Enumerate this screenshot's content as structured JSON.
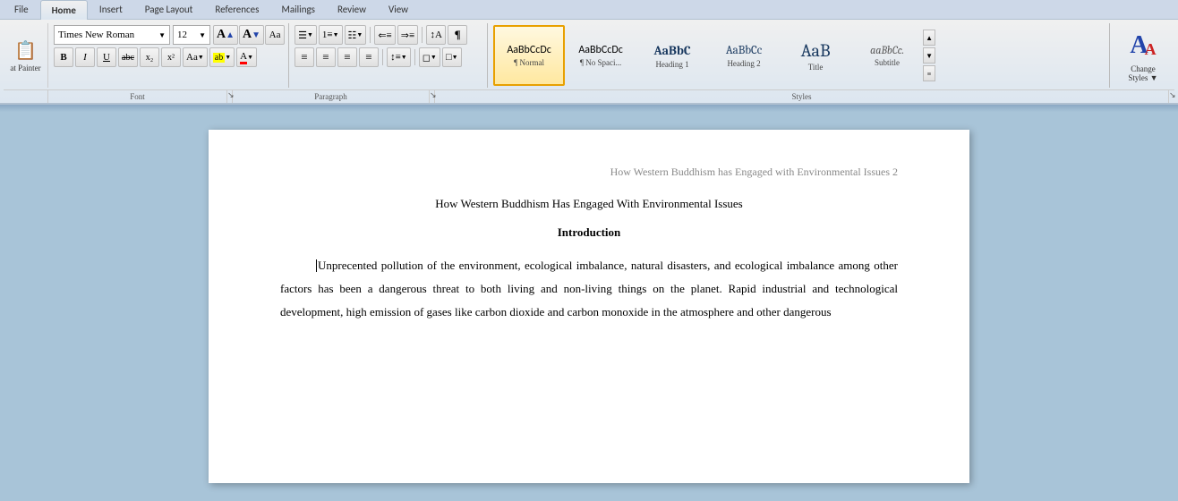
{
  "ribbon": {
    "tabs": [
      "File",
      "Home",
      "Insert",
      "Page Layout",
      "References",
      "Mailings",
      "Review",
      "View"
    ],
    "active_tab": "Home"
  },
  "toolbar": {
    "format_painter_label": "at Painter",
    "font": {
      "name": "Times New Roman",
      "size": "12",
      "grow_label": "A",
      "shrink_label": "A",
      "clear_label": "Aa",
      "bold": "B",
      "italic": "I",
      "underline": "U",
      "strikethrough": "abc",
      "subscript": "x₂",
      "superscript": "x²",
      "font_color": "A",
      "highlight": "ab"
    },
    "paragraph": {
      "bullets_label": "≡",
      "numbering_label": "≡",
      "multilevel_label": "≡",
      "decrease_indent": "⇐",
      "increase_indent": "⇒",
      "sort_label": "↕",
      "show_all_label": "¶",
      "align_left": "≡",
      "align_center": "≡",
      "align_right": "≡",
      "justify": "≡",
      "line_spacing": "↕",
      "shading": "◻",
      "borders": "□",
      "label": "Paragraph"
    },
    "styles": {
      "label": "Styles",
      "items": [
        {
          "name": "¶ Normal",
          "text": "AaBbCcDc",
          "active": true
        },
        {
          "name": "¶ No Spaci...",
          "text": "AaBbCcDc",
          "active": false
        },
        {
          "name": "Heading 1",
          "text": "AaBbC",
          "active": false
        },
        {
          "name": "Heading 2",
          "text": "AaBbCc",
          "active": false
        },
        {
          "name": "Title",
          "text": "AaB",
          "active": false
        },
        {
          "name": "Subtitle",
          "text": "aaBbCc.",
          "active": false
        }
      ]
    },
    "change_styles": {
      "label": "Change\nStyles",
      "icon_big": "A",
      "icon_small": "A"
    },
    "font_section_label": "Font",
    "para_section_label": "Paragraph",
    "styles_section_label": "Styles"
  },
  "document": {
    "header": "How Western Buddhism has Engaged with Environmental Issues 2",
    "title": "How Western Buddhism Has Engaged With Environmental Issues",
    "subtitle": "Introduction",
    "body_text": "Unprecented pollution of the environment, ecological imbalance, natural disasters, and ecological imbalance among other factors has been a dangerous threat to both living and non-living things on the planet. Rapid industrial and technological development, high emission of gases like carbon dioxide and carbon monoxide in the atmosphere and other dangerous"
  }
}
